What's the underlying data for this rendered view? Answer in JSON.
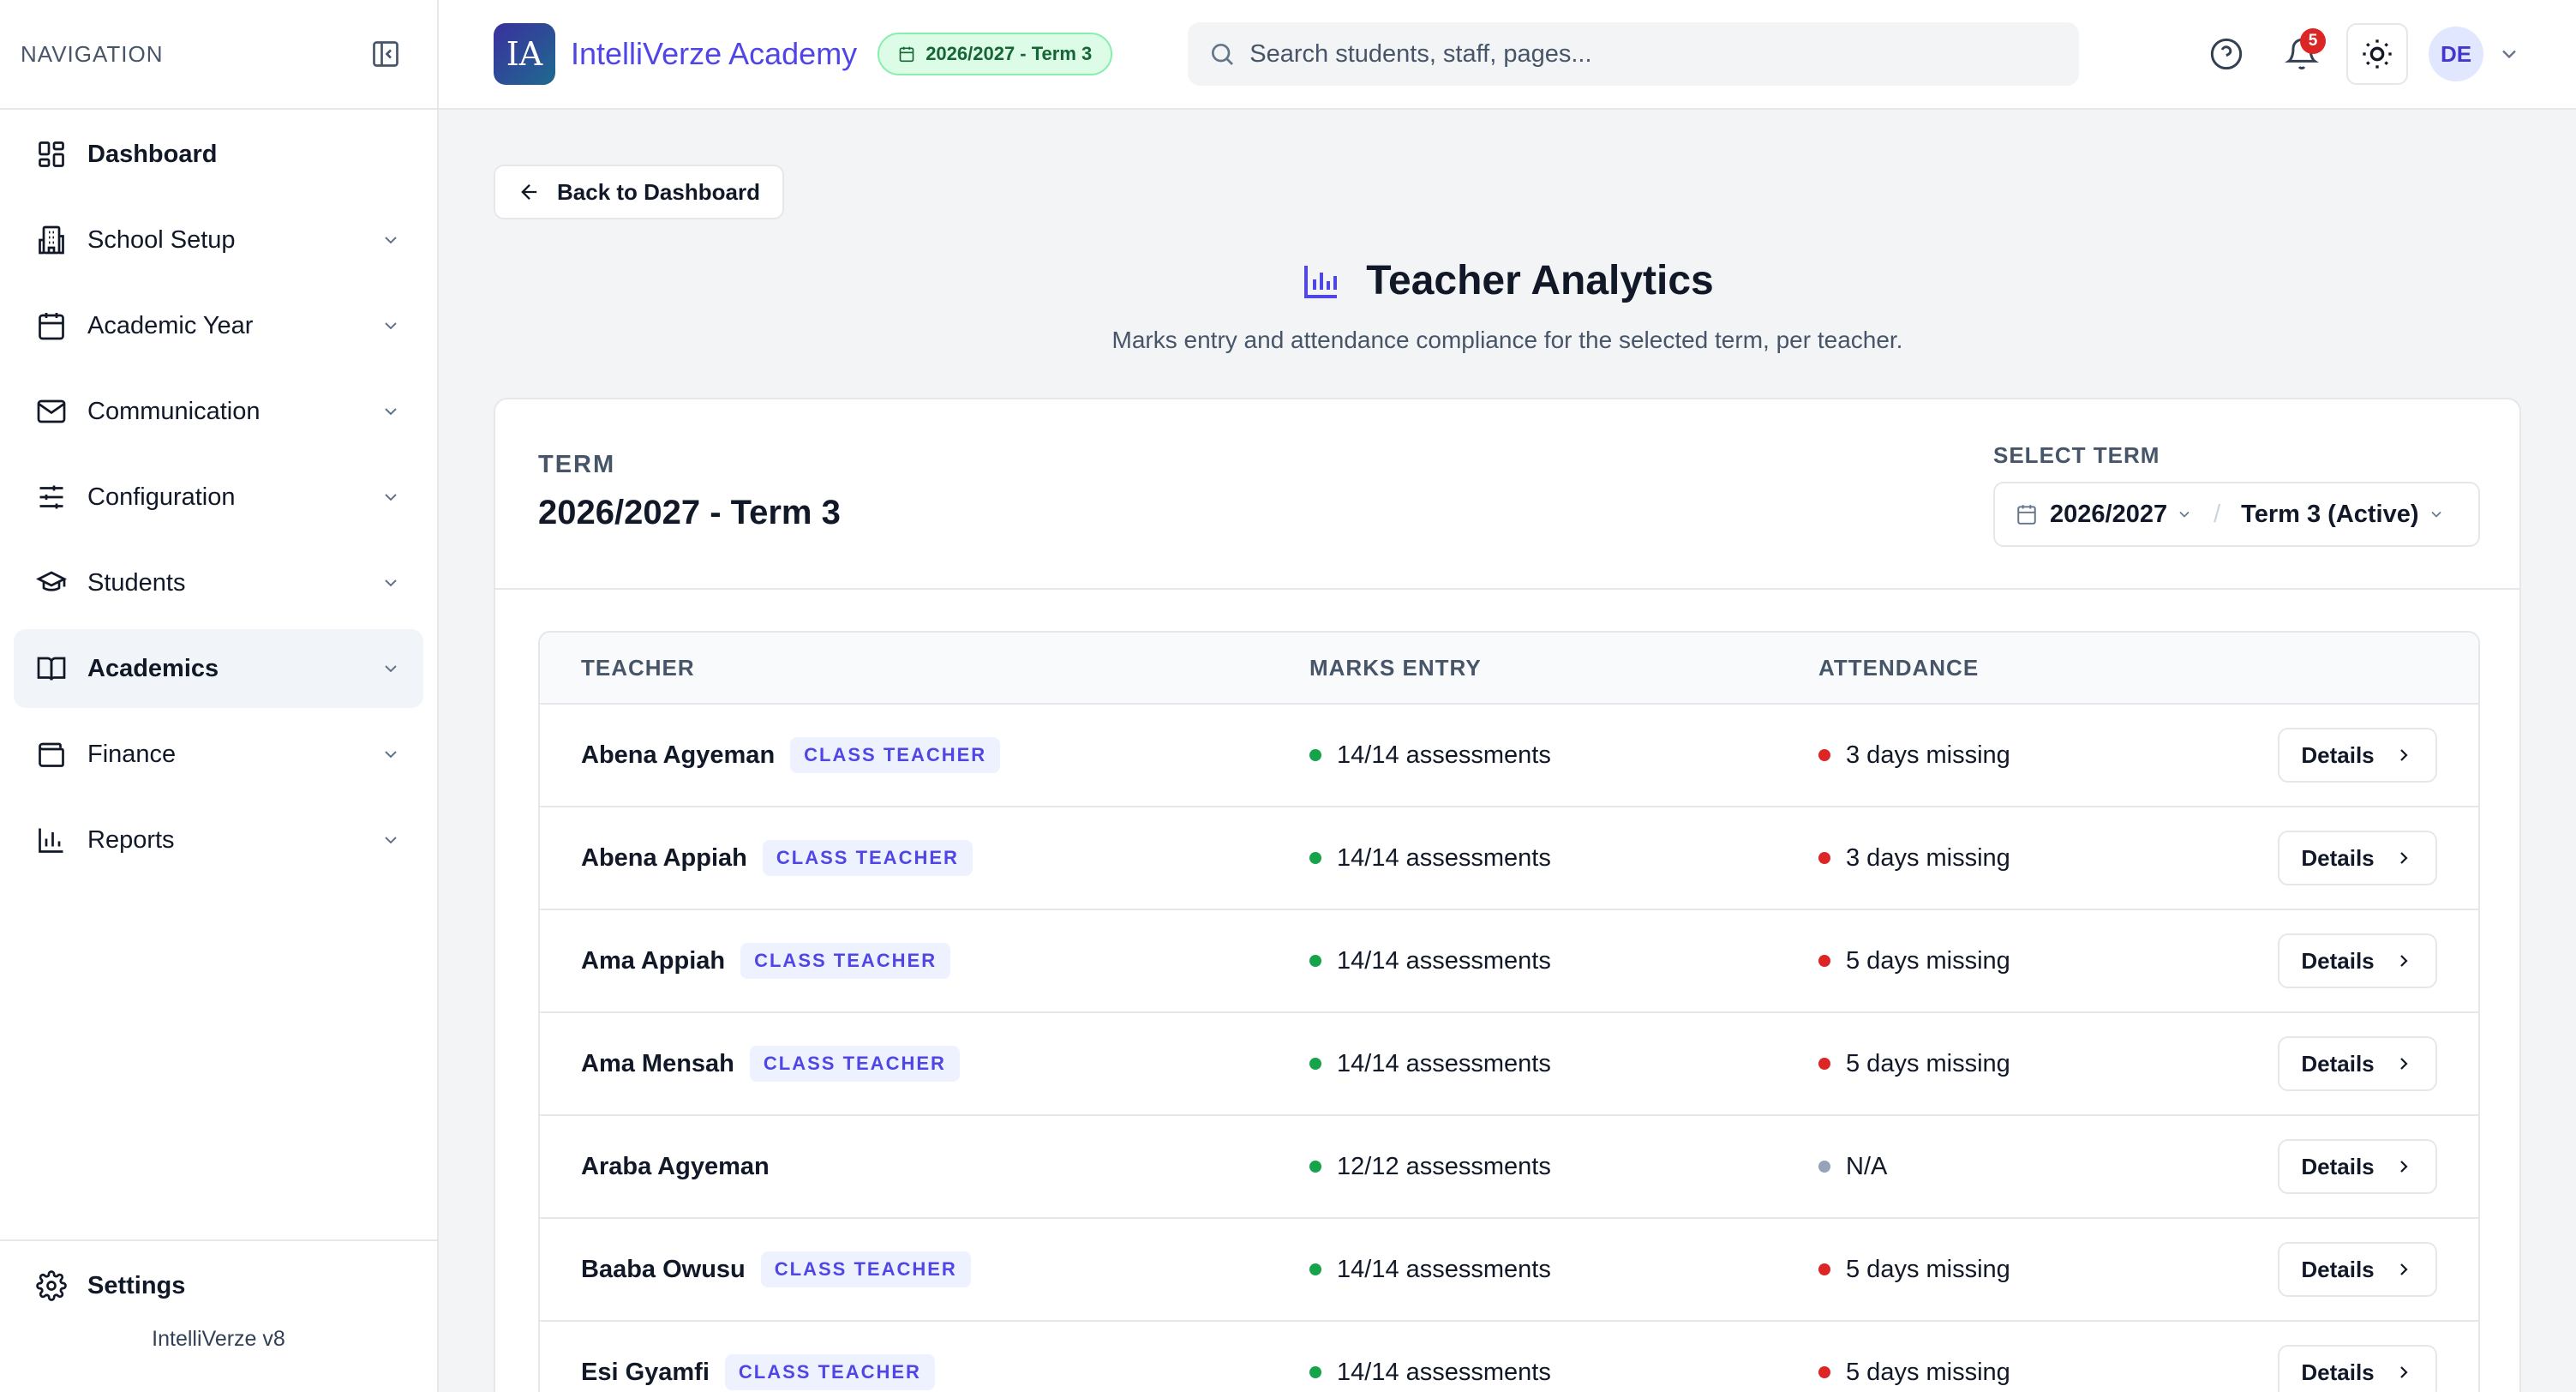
{
  "sidebar": {
    "title": "NAVIGATION",
    "items": [
      {
        "label": "Dashboard",
        "icon": "dashboard-icon"
      },
      {
        "label": "School Setup",
        "icon": "building-icon"
      },
      {
        "label": "Academic Year",
        "icon": "calendar-icon"
      },
      {
        "label": "Communication",
        "icon": "mail-icon"
      },
      {
        "label": "Configuration",
        "icon": "sliders-icon"
      },
      {
        "label": "Students",
        "icon": "graduation-cap-icon"
      },
      {
        "label": "Academics",
        "icon": "book-icon"
      },
      {
        "label": "Finance",
        "icon": "wallet-icon"
      },
      {
        "label": "Reports",
        "icon": "bar-chart-icon"
      }
    ],
    "settings_label": "Settings",
    "version": "IntelliVerze v8"
  },
  "header": {
    "logo_text": "IA",
    "brand": "IntelliVerze Academy",
    "term_pill": "2026/2027 - Term 3",
    "search_placeholder": "Search students, staff, pages...",
    "notification_count": "5",
    "avatar": "DE"
  },
  "page": {
    "back_label": "Back to Dashboard",
    "title": "Teacher Analytics",
    "subtitle": "Marks entry and attendance compliance for the selected term, per teacher.",
    "term_label": "TERM",
    "term_value": "2026/2027 - Term 3",
    "select_label": "SELECT TERM",
    "select_year": "2026/2027",
    "select_term": "Term 3 (Active)"
  },
  "table": {
    "headers": [
      "TEACHER",
      "MARKS ENTRY",
      "ATTENDANCE"
    ],
    "details_label": "Details",
    "rows": [
      {
        "name": "Abena Agyeman",
        "badge": "CLASS TEACHER",
        "marks": "14/14 assessments",
        "attendance": "3 days missing",
        "att_status": "missing"
      },
      {
        "name": "Abena Appiah",
        "badge": "CLASS TEACHER",
        "marks": "14/14 assessments",
        "attendance": "3 days missing",
        "att_status": "missing"
      },
      {
        "name": "Ama Appiah",
        "badge": "CLASS TEACHER",
        "marks": "14/14 assessments",
        "attendance": "5 days missing",
        "att_status": "missing"
      },
      {
        "name": "Ama Mensah",
        "badge": "CLASS TEACHER",
        "marks": "14/14 assessments",
        "attendance": "5 days missing",
        "att_status": "missing"
      },
      {
        "name": "Araba Agyeman",
        "badge": "",
        "marks": "12/12 assessments",
        "attendance": "N/A",
        "att_status": "na"
      },
      {
        "name": "Baaba Owusu",
        "badge": "CLASS TEACHER",
        "marks": "14/14 assessments",
        "attendance": "5 days missing",
        "att_status": "missing"
      },
      {
        "name": "Esi Gyamfi",
        "badge": "CLASS TEACHER",
        "marks": "14/14 assessments",
        "attendance": "5 days missing",
        "att_status": "missing"
      }
    ]
  },
  "colors": {
    "accent": "#4f46e5",
    "ok": "#16a34a",
    "missing": "#dc2626",
    "na": "#94a3b8"
  }
}
